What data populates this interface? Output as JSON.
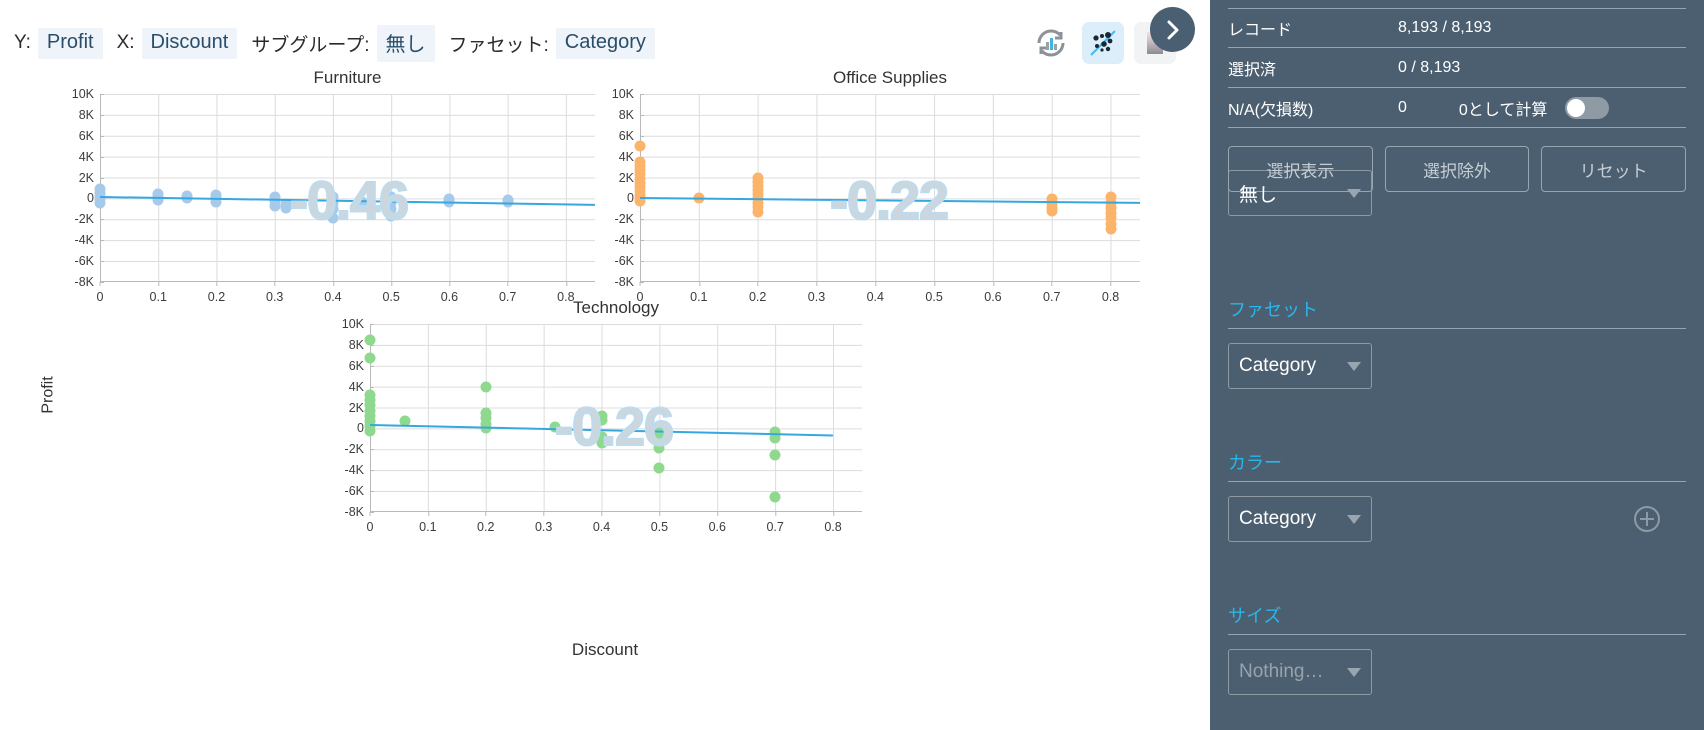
{
  "toolbar": {
    "y_label": "Y:",
    "y_value": "Profit",
    "x_label": "X:",
    "x_value": "Discount",
    "subgroup_label": "サブグループ:",
    "subgroup_value": "無し",
    "facet_label": "ファセット:",
    "facet_value": "Category",
    "icons": {
      "refresh_chart": "refresh-chart-icon",
      "scatter": "scatter-plot-icon",
      "heatmap": "heatmap-icon",
      "expand": "chevron-right-icon"
    }
  },
  "panel": {
    "stats": [
      {
        "label": "レコード",
        "value": "8,193 / 8,193"
      },
      {
        "label": "選択済",
        "value": "0 / 8,193"
      },
      {
        "label": "N/A(欠損数)",
        "value": "0",
        "extra": "0として計算"
      }
    ],
    "buttons": [
      "選択表示",
      "選択除外",
      "リセット"
    ],
    "subgroup_select": "無し",
    "sections": [
      {
        "title": "ファセット",
        "value": "Category"
      },
      {
        "title": "カラー",
        "value": "Category"
      },
      {
        "title": "サイズ",
        "value": "Nothing…"
      }
    ]
  },
  "chart_data": {
    "type": "scatter",
    "title": "",
    "xlabel": "Discount",
    "ylabel": "Profit",
    "xlim": [
      0,
      0.85
    ],
    "ylim": [
      -8000,
      10000
    ],
    "xticks": [
      "0",
      "0.1",
      "0.2",
      "0.3",
      "0.4",
      "0.5",
      "0.6",
      "0.7",
      "0.8"
    ],
    "xtickvals": [
      0,
      0.1,
      0.2,
      0.3,
      0.4,
      0.5,
      0.6,
      0.7,
      0.8
    ],
    "yticks": [
      "10K",
      "8K",
      "6K",
      "4K",
      "2K",
      "0",
      "-2K",
      "-4K",
      "-6K",
      "-8K"
    ],
    "ytickvals": [
      10000,
      8000,
      6000,
      4000,
      2000,
      0,
      -2000,
      -4000,
      -6000,
      -8000
    ],
    "grid": true,
    "legend": "none",
    "facet_by": "Category",
    "facets": [
      {
        "name": "Furniture",
        "correlation": "-0.46",
        "color": "#a7caeb",
        "trend": {
          "x0": 0.0,
          "y0": 250,
          "x1": 0.85,
          "y1": -500
        },
        "points": [
          [
            0.0,
            500
          ],
          [
            0.0,
            150
          ],
          [
            0.0,
            -100
          ],
          [
            0.0,
            900
          ],
          [
            0.0,
            -400
          ],
          [
            0.1,
            450
          ],
          [
            0.1,
            100
          ],
          [
            0.1,
            -150
          ],
          [
            0.15,
            200
          ],
          [
            0.15,
            0
          ],
          [
            0.2,
            100
          ],
          [
            0.2,
            -300
          ],
          [
            0.2,
            350
          ],
          [
            0.3,
            -200
          ],
          [
            0.3,
            -700
          ],
          [
            0.3,
            150
          ],
          [
            0.32,
            -500
          ],
          [
            0.32,
            -900
          ],
          [
            0.4,
            -400
          ],
          [
            0.4,
            -1000
          ],
          [
            0.4,
            -1900
          ],
          [
            0.4,
            100
          ],
          [
            0.45,
            -300
          ],
          [
            0.45,
            -800
          ],
          [
            0.5,
            -400
          ],
          [
            0.5,
            -1000
          ],
          [
            0.5,
            -1700
          ],
          [
            0.5,
            100
          ],
          [
            0.6,
            -300
          ],
          [
            0.6,
            -100
          ],
          [
            0.7,
            -350
          ],
          [
            0.7,
            -150
          ]
        ]
      },
      {
        "name": "Office Supplies",
        "correlation": "-0.22",
        "color": "#fbb46a",
        "trend": {
          "x0": 0.0,
          "y0": 120,
          "x1": 0.85,
          "y1": -350
        },
        "points": [
          [
            0.0,
            5000
          ],
          [
            0.0,
            3500
          ],
          [
            0.0,
            3100
          ],
          [
            0.0,
            2700
          ],
          [
            0.0,
            2300
          ],
          [
            0.0,
            1900
          ],
          [
            0.0,
            1500
          ],
          [
            0.0,
            1100
          ],
          [
            0.0,
            700
          ],
          [
            0.0,
            300
          ],
          [
            0.0,
            0
          ],
          [
            0.0,
            -200
          ],
          [
            0.1,
            50
          ],
          [
            0.2,
            2000
          ],
          [
            0.2,
            1600
          ],
          [
            0.2,
            1200
          ],
          [
            0.2,
            800
          ],
          [
            0.2,
            400
          ],
          [
            0.2,
            0
          ],
          [
            0.2,
            -400
          ],
          [
            0.2,
            -800
          ],
          [
            0.2,
            -1300
          ],
          [
            0.7,
            -100
          ],
          [
            0.7,
            -500
          ],
          [
            0.7,
            -900
          ],
          [
            0.7,
            -1200
          ],
          [
            0.8,
            100
          ],
          [
            0.8,
            -400
          ],
          [
            0.8,
            -900
          ],
          [
            0.8,
            -1400
          ],
          [
            0.8,
            -1900
          ],
          [
            0.8,
            -2400
          ],
          [
            0.8,
            -2900
          ]
        ]
      },
      {
        "name": "Technology",
        "correlation": "-0.26",
        "color": "#8fd98f",
        "trend": {
          "x0": 0.0,
          "y0": 400,
          "x1": 0.8,
          "y1": -600
        },
        "points": [
          [
            0.0,
            8500
          ],
          [
            0.0,
            6700
          ],
          [
            0.0,
            3200
          ],
          [
            0.0,
            2700
          ],
          [
            0.0,
            2200
          ],
          [
            0.0,
            1700
          ],
          [
            0.0,
            1200
          ],
          [
            0.0,
            700
          ],
          [
            0.0,
            200
          ],
          [
            0.0,
            -200
          ],
          [
            0.06,
            700
          ],
          [
            0.2,
            4000
          ],
          [
            0.2,
            1500
          ],
          [
            0.2,
            1000
          ],
          [
            0.2,
            400
          ],
          [
            0.2,
            0
          ],
          [
            0.32,
            150
          ],
          [
            0.4,
            1200
          ],
          [
            0.4,
            800
          ],
          [
            0.4,
            -800
          ],
          [
            0.4,
            -1400
          ],
          [
            0.5,
            -200
          ],
          [
            0.5,
            -800
          ],
          [
            0.5,
            -1400
          ],
          [
            0.5,
            -1900
          ],
          [
            0.5,
            -3800
          ],
          [
            0.7,
            -300
          ],
          [
            0.7,
            -900
          ],
          [
            0.7,
            -2500
          ],
          [
            0.7,
            -6600
          ]
        ]
      }
    ]
  }
}
